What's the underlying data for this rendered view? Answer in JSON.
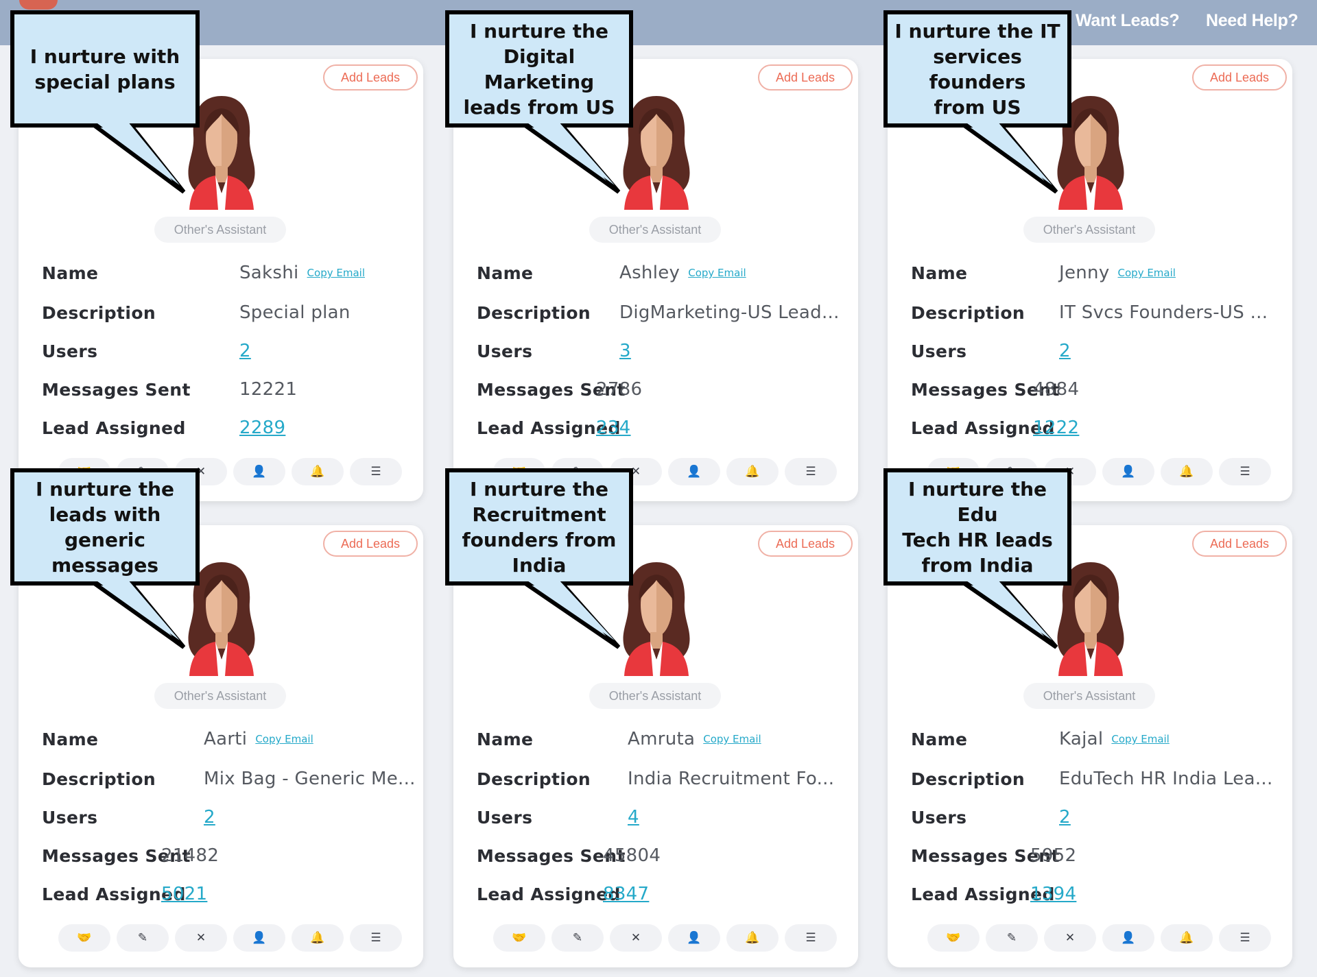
{
  "topbar": {
    "want_leads": "Want Leads?",
    "need_help": "Need Help?"
  },
  "common": {
    "add_leads": "Add Leads",
    "role": "Other's Assistant",
    "copy_email": "Copy Email",
    "labels": {
      "name": "Name",
      "description": "Description",
      "users": "Users",
      "messages_sent": "Messages Sent",
      "lead_assigned": "Lead Assigned"
    },
    "action_icons": [
      "handshake-icon",
      "edit-icon",
      "close-icon",
      "user-check-icon",
      "bell-icon",
      "sliders-icon"
    ],
    "colors": {
      "accent_link": "#25a9c9",
      "add_leads": "#ec6b55",
      "bubble_fill": "#cfe8f8",
      "topbar": "#9badc6"
    }
  },
  "assistants": [
    {
      "name": "Sakshi",
      "description": "Special plan",
      "users": "2",
      "messages_sent": "12221",
      "lead_assigned": "2289",
      "callout": "I nurture with\nspecial plans"
    },
    {
      "name": "Ashley",
      "description": "DigMarketing-US Lead...",
      "users": "3",
      "messages_sent": "2786",
      "lead_assigned": "234",
      "callout": "I nurture the\nDigital Marketing\nleads from US"
    },
    {
      "name": "Jenny",
      "description": "IT Svcs Founders-US ...",
      "users": "2",
      "messages_sent": "4884",
      "lead_assigned": "1222",
      "callout": "I nurture the IT\nservices founders\nfrom US"
    },
    {
      "name": "Aarti",
      "description": "Mix Bag - Generic Me...",
      "users": "2",
      "messages_sent": "21482",
      "lead_assigned": "5021",
      "callout": "I nurture the\nleads with\ngeneric messages"
    },
    {
      "name": "Amruta",
      "description": "India Recruitment Fo...",
      "users": "4",
      "messages_sent": "45804",
      "lead_assigned": "8347",
      "callout": "I nurture the\nRecruitment\nfounders from\nIndia"
    },
    {
      "name": "Kajal",
      "description": "EduTech HR India Lea...",
      "users": "2",
      "messages_sent": "5952",
      "lead_assigned": "1394",
      "callout": "I nurture the Edu\nTech HR leads\nfrom India"
    }
  ]
}
